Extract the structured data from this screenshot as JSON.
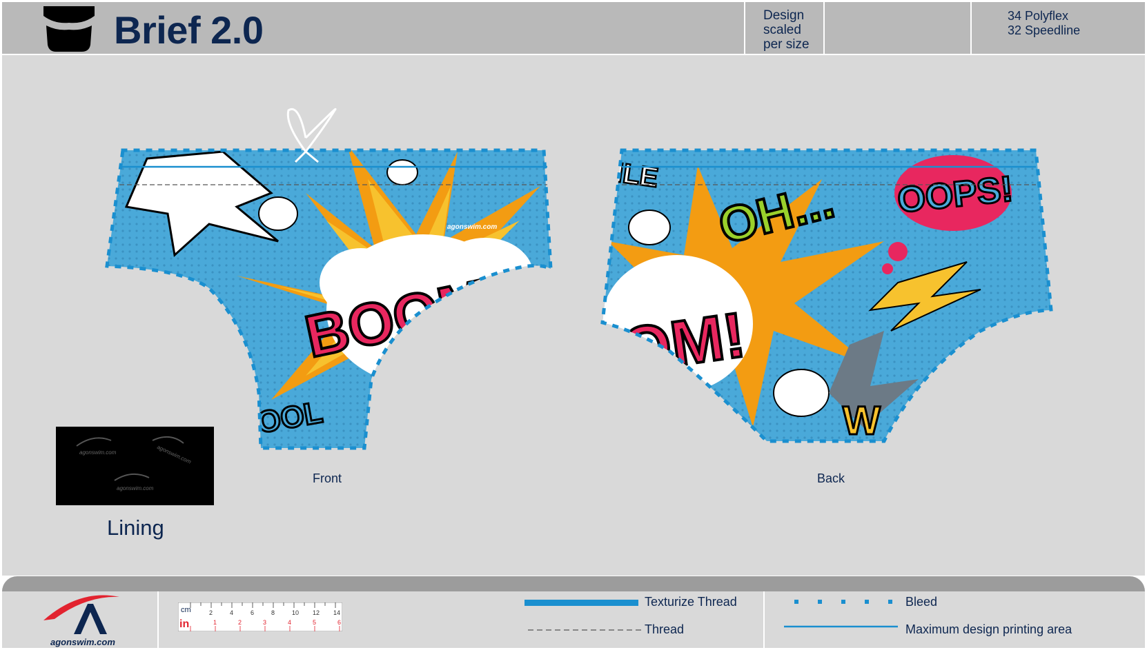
{
  "header": {
    "title": "Brief 2.0",
    "design_note": [
      "Design",
      "scaled",
      "per size"
    ],
    "fabrics": [
      "34 Polyflex",
      "32 Speedline"
    ]
  },
  "panels": {
    "front_label": "Front",
    "back_label": "Back",
    "front_graphics": [
      "BOOM",
      "OOL"
    ],
    "back_graphics": [
      "OH...",
      "OOPS!",
      "OM!",
      "W",
      "ILE"
    ],
    "front_logo": "agonswim.com"
  },
  "lining": {
    "label": "Lining",
    "logos": [
      "agonswim.com",
      "agonswim.com",
      "agonswim.com"
    ]
  },
  "footer": {
    "brand": "agonswim.com",
    "ruler": {
      "cm_label": "cm",
      "in_label": "in",
      "cm_ticks": [
        "2",
        "4",
        "6",
        "8",
        "10",
        "12",
        "14"
      ],
      "in_ticks": [
        "1",
        "2",
        "3",
        "4",
        "5",
        "6"
      ]
    },
    "legend": {
      "texturize_thread": "Texturize Thread",
      "thread": "Thread",
      "bleed": "Bleed",
      "max_area": "Maximum design printing area"
    }
  },
  "colors": {
    "fabric_blue": "#4aa9d9",
    "accent_blue": "#1a8fcf",
    "navy": "#0d2650",
    "boom_pink": "#e8275f",
    "burst_orange": "#f39c12",
    "brand_red": "#e2232f"
  }
}
